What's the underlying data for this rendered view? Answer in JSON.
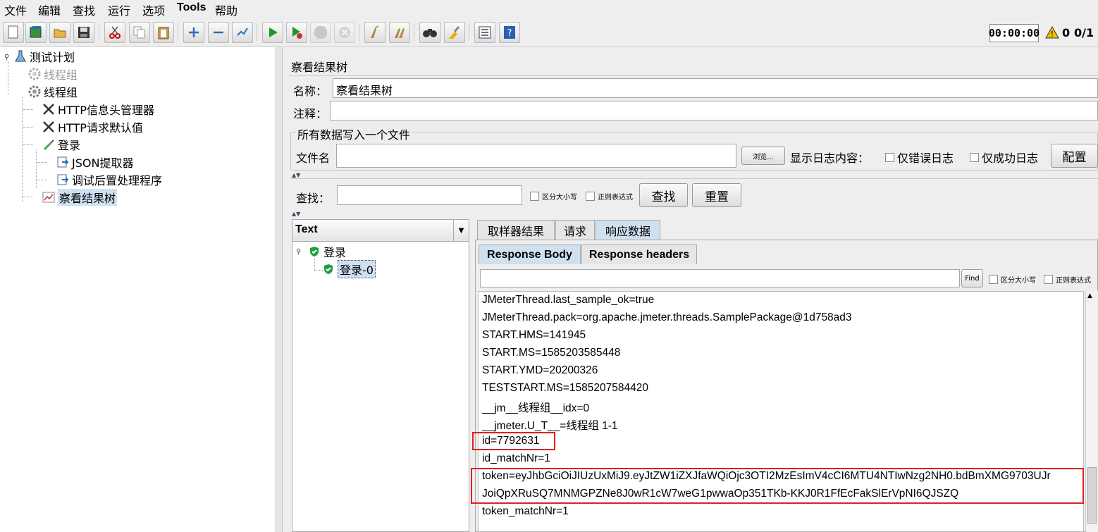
{
  "menu": [
    "文件",
    "编辑",
    "查找",
    "运行",
    "选项",
    "Tools",
    "帮助"
  ],
  "toolbar": {
    "timer": "00:00:00",
    "warning_count": "0",
    "thread_count": "0/1",
    "icons": [
      "new-icon",
      "templates-icon",
      "open-icon",
      "save-icon",
      "cut-icon",
      "copy-icon",
      "paste-icon",
      "expand-icon",
      "collapse-icon",
      "toggle-icon",
      "start-icon",
      "start-no-pause-icon",
      "stop-icon",
      "shutdown-icon",
      "clear-icon",
      "clear-all-icon",
      "search-icon",
      "reset-search-icon",
      "function-helper-icon",
      "help-icon"
    ]
  },
  "tree": {
    "items": [
      {
        "label": "测试计划",
        "icon": "test-plan-icon"
      },
      {
        "label": "线程组",
        "icon": "gear-icon",
        "disabled": true
      },
      {
        "label": "线程组",
        "icon": "gear-icon"
      },
      {
        "label": "HTTP信息头管理器",
        "icon": "wrench-icon"
      },
      {
        "label": "HTTP请求默认值",
        "icon": "wrench-icon"
      },
      {
        "label": "登录",
        "icon": "pipette-icon"
      },
      {
        "label": "JSON提取器",
        "icon": "post-processor-icon"
      },
      {
        "label": "调试后置处理程序",
        "icon": "post-processor-icon"
      },
      {
        "label": "察看结果树",
        "icon": "listener-icon"
      }
    ]
  },
  "panel": {
    "title": "察看结果树",
    "name_label": "名称：",
    "name_value": "察看结果树",
    "comment_label": "注释：",
    "comment_value": "",
    "file_group_title": "所有数据写入一个文件",
    "filename_label": "文件名",
    "filename_value": "",
    "browse_label": "浏览...",
    "log_content_label": "显示日志内容：",
    "errors_only_label": "仅错误日志",
    "success_only_label": "仅成功日志",
    "configure_label": "配置",
    "search_label": "查找：",
    "search_value": "",
    "case_sensitive_label": "区分大小写",
    "regex_label": "正则表达式",
    "search_button": "查找",
    "reset_button": "重置"
  },
  "results": {
    "renderer": "Text",
    "samples": [
      {
        "label": "登录"
      },
      {
        "label": "登录-0"
      }
    ]
  },
  "tabs": {
    "main": [
      "取样器结果",
      "请求",
      "响应数据"
    ],
    "main_active": "响应数据",
    "sub": [
      "Response Body",
      "Response headers"
    ],
    "sub_active": "Response Body"
  },
  "response_search": {
    "value": "",
    "find_label": "Find",
    "case_label": "区分大小写",
    "regex_label": "正则表达式"
  },
  "response_lines": [
    "JMeterThread.last_sample_ok=true",
    "JMeterThread.pack=org.apache.jmeter.threads.SamplePackage@1d758ad3",
    "START.HMS=141945",
    "START.MS=1585203585448",
    "START.YMD=20200326",
    "TESTSTART.MS=1585207584420",
    "__jm__线程组__idx=0",
    "__jmeter.U_T__=线程组 1-1",
    "id=7792631",
    "id_matchNr=1",
    "token=eyJhbGciOiJIUzUxMiJ9.eyJtZW1iZXJfaWQiOjc3OTI2MzEsImV4cCI6MTU4NTIwNzg2NH0.bdBmXMG9703UJr",
    "JoiQpXRuSQ7MNMGPZNe8J0wR1cW7weG1pwwaOp351TKb-KKJ0R1FfEcFakSlErVpNI6QJSZQ",
    "token_matchNr=1"
  ],
  "highlight_color": "#e02020"
}
